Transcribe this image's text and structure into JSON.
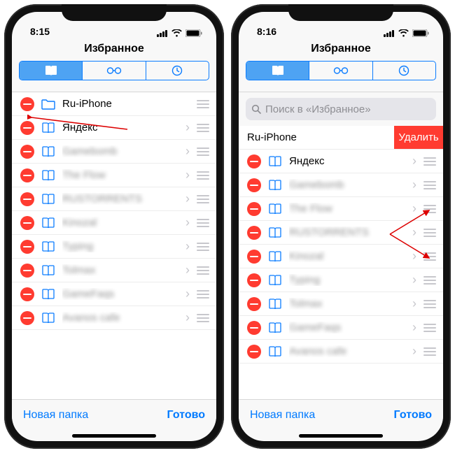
{
  "phones": {
    "left": {
      "time": "8:15",
      "title": "Избранное",
      "rows": [
        {
          "icon": "folder",
          "label": "Ru-iPhone",
          "blurred": false,
          "chev": false
        },
        {
          "icon": "book",
          "label": "Яндекс",
          "blurred": false,
          "chev": true
        },
        {
          "icon": "book",
          "label": "Gamebomb",
          "blurred": true,
          "chev": true
        },
        {
          "icon": "book",
          "label": "The Flow",
          "blurred": true,
          "chev": true
        },
        {
          "icon": "book",
          "label": "RUSTORRENTS",
          "blurred": true,
          "chev": true
        },
        {
          "icon": "book",
          "label": "Kinozal",
          "blurred": true,
          "chev": true
        },
        {
          "icon": "book",
          "label": "Typing",
          "blurred": true,
          "chev": true
        },
        {
          "icon": "book",
          "label": "Tolmax",
          "blurred": true,
          "chev": true
        },
        {
          "icon": "book",
          "label": "GameFaqs",
          "blurred": true,
          "chev": true
        },
        {
          "icon": "book",
          "label": "Avanos cafe",
          "blurred": true,
          "chev": true
        }
      ]
    },
    "right": {
      "time": "8:16",
      "title": "Избранное",
      "search_placeholder": "Поиск в «Избранное»",
      "delete_label": "Удалить",
      "swiped_label": "Ru-iPhone",
      "rows": [
        {
          "icon": "book",
          "label": "Яндекс",
          "blurred": false,
          "chev": true
        },
        {
          "icon": "book",
          "label": "Gamebomb",
          "blurred": true,
          "chev": true
        },
        {
          "icon": "book",
          "label": "The Flow",
          "blurred": true,
          "chev": true
        },
        {
          "icon": "book",
          "label": "RUSTORRENTS",
          "blurred": true,
          "chev": true
        },
        {
          "icon": "book",
          "label": "Kinozal",
          "blurred": true,
          "chev": true
        },
        {
          "icon": "book",
          "label": "Typing",
          "blurred": true,
          "chev": true
        },
        {
          "icon": "book",
          "label": "Tolmax",
          "blurred": true,
          "chev": true
        },
        {
          "icon": "book",
          "label": "GameFaqs",
          "blurred": true,
          "chev": true
        },
        {
          "icon": "book",
          "label": "Avanos cafe",
          "blurred": true,
          "chev": true
        }
      ]
    }
  },
  "toolbar": {
    "new_folder": "Новая папка",
    "done": "Готово"
  },
  "colors": {
    "accent": "#007aff",
    "danger": "#ff3b30",
    "gray": "#c7c7cc"
  }
}
